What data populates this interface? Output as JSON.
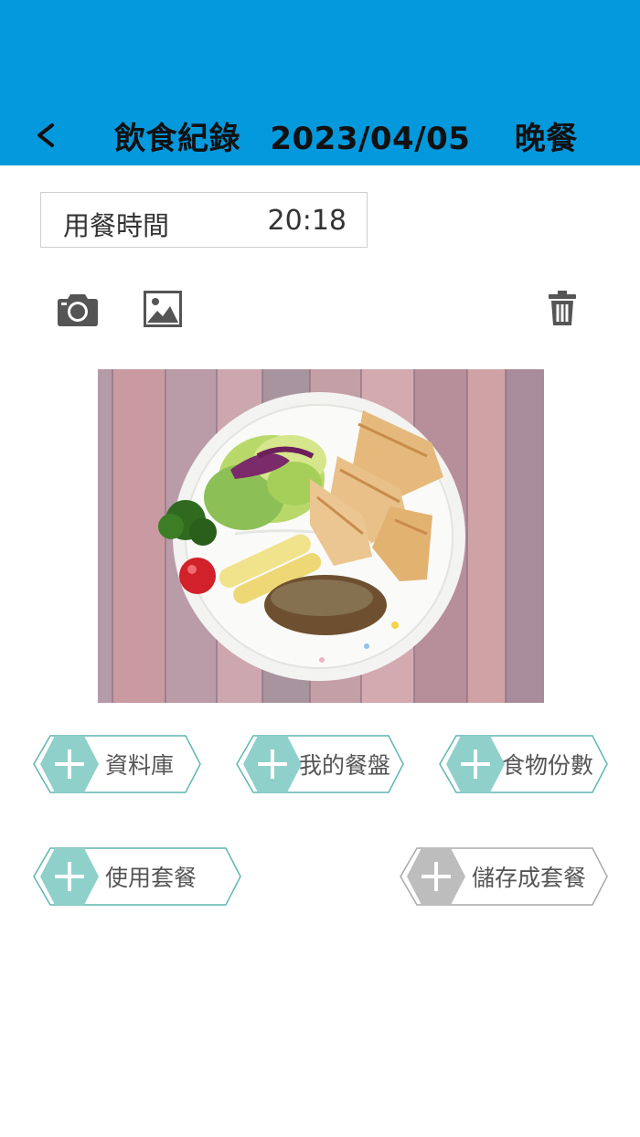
{
  "header": {
    "title": "飲食紀錄",
    "date": "2023/04/05",
    "meal": "晚餐",
    "bg_color": "#0399dc"
  },
  "meal_time": {
    "label": "用餐時間",
    "value": "20:18"
  },
  "icons": {
    "back": "chevron-left-icon",
    "camera": "camera-icon",
    "gallery": "image-icon",
    "delete": "trash-icon"
  },
  "buttons": {
    "database": "資料庫",
    "my_plate": "我的餐盤",
    "portions": "食物份數",
    "use_set": "使用套餐",
    "save_set": "儲存成套餐"
  },
  "colors": {
    "accent": "#8fd0cb",
    "accent_border": "#5fb6b0",
    "disabled": "#bdbdbd",
    "disabled_border": "#a9a9a9"
  }
}
